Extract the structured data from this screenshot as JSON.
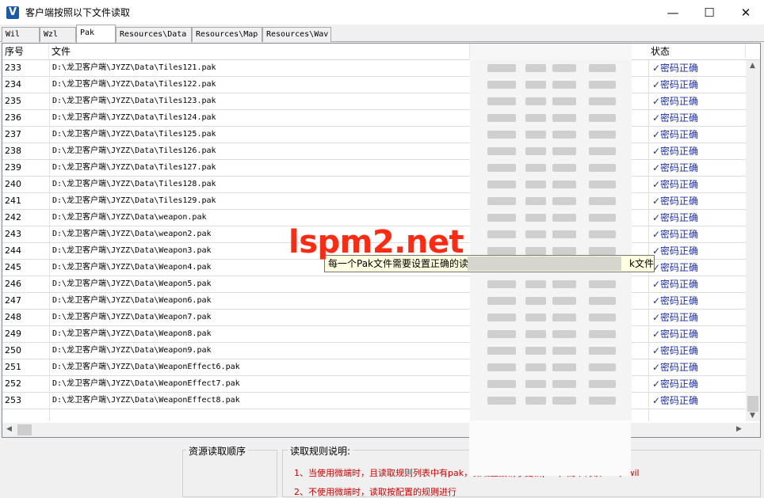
{
  "window": {
    "title": "客户端按照以下文件读取",
    "icon": "V",
    "minimize": "—",
    "maximize": "☐",
    "close": "✕"
  },
  "tabs": [
    {
      "label": "Wil",
      "active": false
    },
    {
      "label": "Wzl",
      "active": false
    },
    {
      "label": "Pak",
      "active": true
    },
    {
      "label": "Resources\\Data",
      "active": false
    },
    {
      "label": "Resources\\Map",
      "active": false
    },
    {
      "label": "Resources\\Wav",
      "active": false
    }
  ],
  "table": {
    "columns": {
      "index": "序号",
      "file": "文件",
      "status": "状态"
    },
    "rows": [
      {
        "index": "233",
        "file": "D:\\龙卫客户端\\JYZZ\\Data\\Tiles121.pak",
        "status": "✓密码正确"
      },
      {
        "index": "234",
        "file": "D:\\龙卫客户端\\JYZZ\\Data\\Tiles122.pak",
        "status": "✓密码正确"
      },
      {
        "index": "235",
        "file": "D:\\龙卫客户端\\JYZZ\\Data\\Tiles123.pak",
        "status": "✓密码正确"
      },
      {
        "index": "236",
        "file": "D:\\龙卫客户端\\JYZZ\\Data\\Tiles124.pak",
        "status": "✓密码正确"
      },
      {
        "index": "237",
        "file": "D:\\龙卫客户端\\JYZZ\\Data\\Tiles125.pak",
        "status": "✓密码正确"
      },
      {
        "index": "238",
        "file": "D:\\龙卫客户端\\JYZZ\\Data\\Tiles126.pak",
        "status": "✓密码正确"
      },
      {
        "index": "239",
        "file": "D:\\龙卫客户端\\JYZZ\\Data\\Tiles127.pak",
        "status": "✓密码正确"
      },
      {
        "index": "240",
        "file": "D:\\龙卫客户端\\JYZZ\\Data\\Tiles128.pak",
        "status": "✓密码正确"
      },
      {
        "index": "241",
        "file": "D:\\龙卫客户端\\JYZZ\\Data\\Tiles129.pak",
        "status": "✓密码正确"
      },
      {
        "index": "242",
        "file": "D:\\龙卫客户端\\JYZZ\\Data\\weapon.pak",
        "status": "✓密码正确"
      },
      {
        "index": "243",
        "file": "D:\\龙卫客户端\\JYZZ\\Data\\weapon2.pak",
        "status": "✓密码正确"
      },
      {
        "index": "244",
        "file": "D:\\龙卫客户端\\JYZZ\\Data\\Weapon3.pak",
        "status": "✓密码正确"
      },
      {
        "index": "245",
        "file": "D:\\龙卫客户端\\JYZZ\\Data\\Weapon4.pak",
        "status": "✓密码正确"
      },
      {
        "index": "246",
        "file": "D:\\龙卫客户端\\JYZZ\\Data\\Weapon5.pak",
        "status": "✓密码正确"
      },
      {
        "index": "247",
        "file": "D:\\龙卫客户端\\JYZZ\\Data\\Weapon6.pak",
        "status": "✓密码正确"
      },
      {
        "index": "248",
        "file": "D:\\龙卫客户端\\JYZZ\\Data\\Weapon7.pak",
        "status": "✓密码正确"
      },
      {
        "index": "249",
        "file": "D:\\龙卫客户端\\JYZZ\\Data\\Weapon8.pak",
        "status": "✓密码正确"
      },
      {
        "index": "250",
        "file": "D:\\龙卫客户端\\JYZZ\\Data\\Weapon9.pak",
        "status": "✓密码正确"
      },
      {
        "index": "251",
        "file": "D:\\龙卫客户端\\JYZZ\\Data\\WeaponEffect6.pak",
        "status": "✓密码正确"
      },
      {
        "index": "252",
        "file": "D:\\龙卫客户端\\JYZZ\\Data\\WeaponEffect7.pak",
        "status": "✓密码正确"
      },
      {
        "index": "253",
        "file": "D:\\龙卫客户端\\JYZZ\\Data\\WeaponEffect8.pak",
        "status": "✓密码正确"
      }
    ]
  },
  "tooltip": {
    "text_left": "每一个Pak文件需要设置正确的读",
    "text_right": "k文件"
  },
  "watermark": "lspm2.net",
  "bottom": {
    "order_label": "资源读取顺序",
    "rules_label": "读取规则说明:",
    "rules": [
      "1、当使用微端时，且读取规则列表中有pak，微端直接请求更新pak，而不再读 wzl，wil",
      "2、不使用微端时，读取按配置的规则进行"
    ]
  },
  "colors": {
    "status_text": "#1a2ea8",
    "rule_text": "#d10000",
    "watermark": "#ff2a12",
    "tooltip_bg": "#ffffe1"
  }
}
